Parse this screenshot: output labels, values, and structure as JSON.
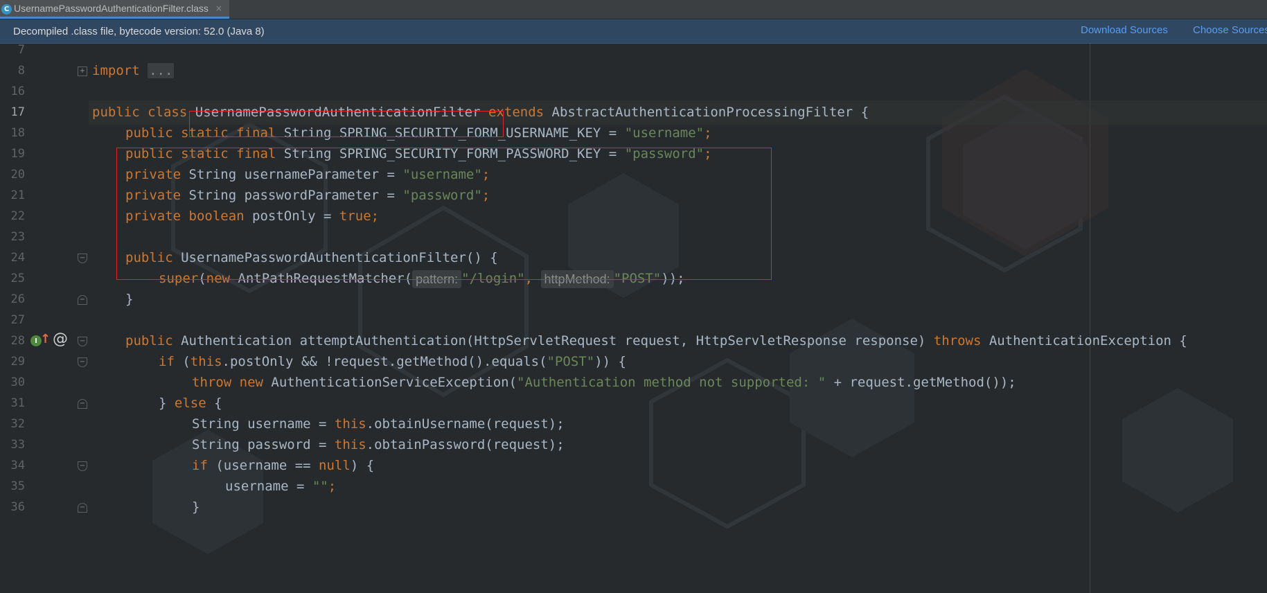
{
  "tab": {
    "icon": "class-file-icon",
    "icon_glyph": "C",
    "label": "UsernamePasswordAuthenticationFilter.class",
    "close": "×"
  },
  "notice": {
    "text": "Decompiled .class file, bytecode version: 52.0 (Java 8)",
    "download_sources": "Download Sources",
    "choose_sources": "Choose Sources..."
  },
  "code": {
    "line_numbers": [
      "7",
      "8",
      "16",
      "17",
      "18",
      "19",
      "20",
      "21",
      "22",
      "23",
      "24",
      "25",
      "26",
      "27",
      "28",
      "29",
      "30",
      "31",
      "32",
      "33",
      "34",
      "35",
      "36"
    ],
    "import_kw": "import",
    "import_collapsed": "...",
    "class_decl": {
      "public": "public",
      "class": "class",
      "name": "UsernamePasswordAuthenticationFilter",
      "extends": "extends",
      "parent": "AbstractAuthenticationProcessingFilter",
      "brace": "{"
    },
    "fields": [
      {
        "mods": "public static final",
        "type": " String ",
        "name": "SPRING_SECURITY_FORM_USERNAME_KEY",
        "eq": " = ",
        "value": "\"username\"",
        "semi": ";"
      },
      {
        "mods": "public static final",
        "type": " String ",
        "name": "SPRING_SECURITY_FORM_PASSWORD_KEY",
        "eq": " = ",
        "value": "\"password\"",
        "semi": ";"
      },
      {
        "mods": "private",
        "type": " String ",
        "name": "usernameParameter",
        "eq": " = ",
        "value": "\"username\"",
        "semi": ";"
      },
      {
        "mods": "private",
        "type": " String ",
        "name": "passwordParameter",
        "eq": " = ",
        "value": "\"password\"",
        "semi": ";"
      },
      {
        "mods": "private boolean",
        "type": " ",
        "name": "postOnly",
        "eq": " = ",
        "value": "true",
        "semi": ";"
      }
    ],
    "ctor_decl": {
      "public": "public",
      "rest": " UsernamePasswordAuthenticationFilter() {"
    },
    "super_call": {
      "super": "super",
      "open": "(",
      "new": "new",
      "cls": " AntPathRequestMatcher(",
      "hint_pattern": "pattern:",
      "pattern_value": "\"/login\"",
      "comma": ", ",
      "hint_method": "httpMethod:",
      "method_value": "\"POST\"",
      "close": "));"
    },
    "close_brace": "}",
    "method_decl": {
      "public": "public",
      "sig": " Authentication attemptAuthentication(HttpServletRequest request, HttpServletResponse response) ",
      "throws": "throws",
      "exc": " AuthenticationException {"
    },
    "if_post": {
      "if": "if",
      "p1": " (",
      "this": "this",
      "p2": ".postOnly && !request.getMethod().equals(",
      "post": "\"POST\"",
      "p3": ")) {"
    },
    "throw_line": {
      "throw": "throw",
      "new": "new",
      "cls": " AuthenticationServiceException(",
      "msg": "\"Authentication method not supported: \"",
      "rest": " + request.getMethod());"
    },
    "else_line": {
      "brace1": "} ",
      "else": "else",
      "brace2": " {"
    },
    "username_line": {
      "pre": "String username = ",
      "this": "this",
      "post": ".obtainUsername(request);"
    },
    "password_line": {
      "pre": "String password = ",
      "this": "this",
      "post": ".obtainPassword(request);"
    },
    "if_null": {
      "if": "if",
      "pre": " (username == ",
      "null": "null",
      "post": ") {"
    },
    "assign_empty": {
      "pre": "username = ",
      "value": "\"\"",
      "semi": ";"
    },
    "closing_brace": "}"
  },
  "gutter": {
    "implements_badge": "I",
    "override_arrow": "↑",
    "annotation_icon": "@"
  },
  "colors": {
    "keyword": "#cc7832",
    "string": "#6a8759",
    "text": "#a9b7c6",
    "highlight_box": "#e0262a",
    "link": "#589df6"
  }
}
